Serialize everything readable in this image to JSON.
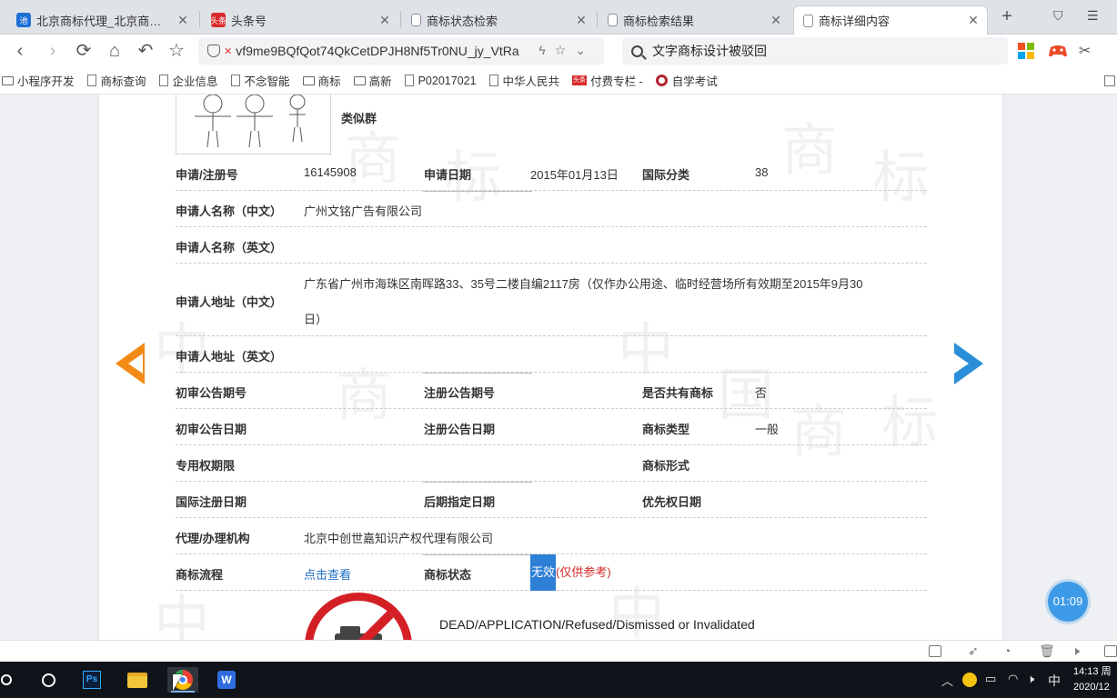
{
  "tabs": [
    {
      "title": "北京商标代理_北京商标注册代",
      "icon": "site-logo-icon"
    },
    {
      "title": "头条号",
      "icon": "toutiao-icon"
    },
    {
      "title": "商标状态检索",
      "icon": "page-icon"
    },
    {
      "title": "商标检索结果",
      "icon": "page-icon"
    },
    {
      "title": "商标详细内容",
      "icon": "page-icon",
      "active": true
    }
  ],
  "url": "vf9me9BQfQot74QkCetDPJH8Nf5Tr0NU_jy_VtRa",
  "search_text": "文字商标设计被驳回",
  "bookmarks": [
    {
      "label": "小程序开发",
      "type": "folder"
    },
    {
      "label": "商标查询",
      "type": "page"
    },
    {
      "label": "企业信息",
      "type": "page"
    },
    {
      "label": "不念智能",
      "type": "page"
    },
    {
      "label": "商标",
      "type": "folder"
    },
    {
      "label": "高新",
      "type": "folder"
    },
    {
      "label": "P02017021",
      "type": "page"
    },
    {
      "label": "中华人民共",
      "type": "page"
    },
    {
      "label": "付费专栏 -",
      "type": "red"
    },
    {
      "label": "自学考试",
      "type": "ring"
    }
  ],
  "detail": {
    "similar_group_label": "类似群",
    "reg_no_label": "申请/注册号",
    "reg_no": "16145908",
    "apply_date_label": "申请日期",
    "apply_date": "2015年01月13日",
    "intl_class_label": "国际分类",
    "intl_class": "38",
    "applicant_cn_label": "申请人名称（中文）",
    "applicant_cn": "广州文铭广告有限公司",
    "applicant_en_label": "申请人名称（英文）",
    "address_cn_label": "申请人地址（中文）",
    "address_cn_line1": "广东省广州市海珠区南晖路33、35号二楼自编2117房（仅作办公用途、临时经营场所有效期至2015年9月30",
    "address_cn_line2": "日）",
    "address_en_label": "申请人地址（英文）",
    "prelim_pub_no_label": "初审公告期号",
    "reg_pub_no_label": "注册公告期号",
    "shared_label": "是否共有商标",
    "shared": "否",
    "prelim_pub_date_label": "初审公告日期",
    "reg_pub_date_label": "注册公告日期",
    "tm_type_label": "商标类型",
    "tm_type": "一般",
    "exclusive_period_label": "专用权期限",
    "tm_form_label": "商标形式",
    "intl_reg_date_label": "国际注册日期",
    "later_designation_label": "后期指定日期",
    "priority_date_label": "优先权日期",
    "agent_label": "代理/办理机构",
    "agent": "北京中创世嘉知识产权代理有限公司",
    "process_label": "商标流程",
    "process_link": "点击查看",
    "status_label": "商标状态",
    "status_value": "无效",
    "status_note": "(仅供参考)",
    "dead_text": "DEAD/APPLICATION/Refused/Dismissed or Invalidated"
  },
  "timer": "01:09",
  "taskbar": {
    "ime": "中",
    "time": "14:13 周",
    "date": "2020/12"
  },
  "colors": {
    "accent_blue": "#2e7fd6",
    "prev_arrow": "#f28b16",
    "next_arrow": "#2a8fd8",
    "dead_red": "#d51f26",
    "note_red": "#d42a2a"
  }
}
